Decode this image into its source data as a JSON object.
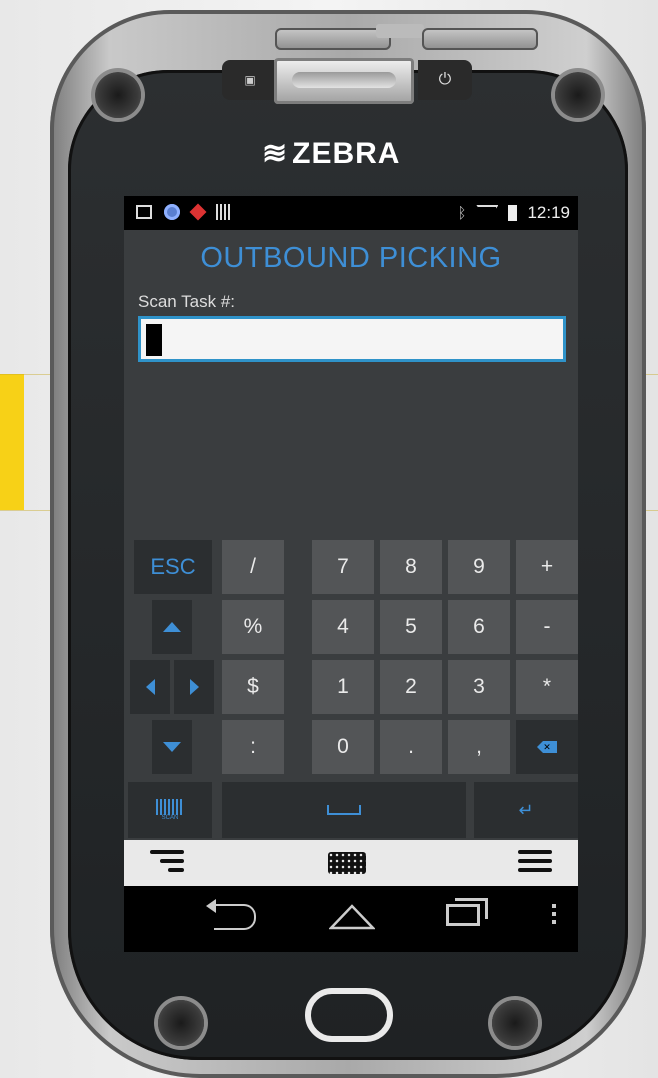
{
  "device": {
    "brand": "ZEBRA",
    "logo_mark": "≋"
  },
  "status_bar": {
    "left_icons": [
      "image-icon",
      "globe-icon",
      "alert-icon",
      "barcode-icon"
    ],
    "right_icons": [
      "bluetooth-icon",
      "wifi-icon",
      "battery-icon"
    ],
    "time": "12:19"
  },
  "app": {
    "title": "OUTBOUND PICKING",
    "field_label": "Scan Task #:",
    "field_value": "",
    "field_placeholder": ""
  },
  "keyboard": {
    "esc": "ESC",
    "slash": "/",
    "percent": "%",
    "dollar": "$",
    "colon": ":",
    "k7": "7",
    "k8": "8",
    "k9": "9",
    "plus": "+",
    "k4": "4",
    "k5": "5",
    "k6": "6",
    "minus": "-",
    "k1": "1",
    "k2": "2",
    "k3": "3",
    "star": "*",
    "k0": "0",
    "dot": ".",
    "comma": ",",
    "scan_label": "SCAN"
  },
  "colors": {
    "accent": "#3e8fd6",
    "screen_bg": "#3a3d3f",
    "key_bg": "#535557",
    "yellow": "#f7d117"
  }
}
